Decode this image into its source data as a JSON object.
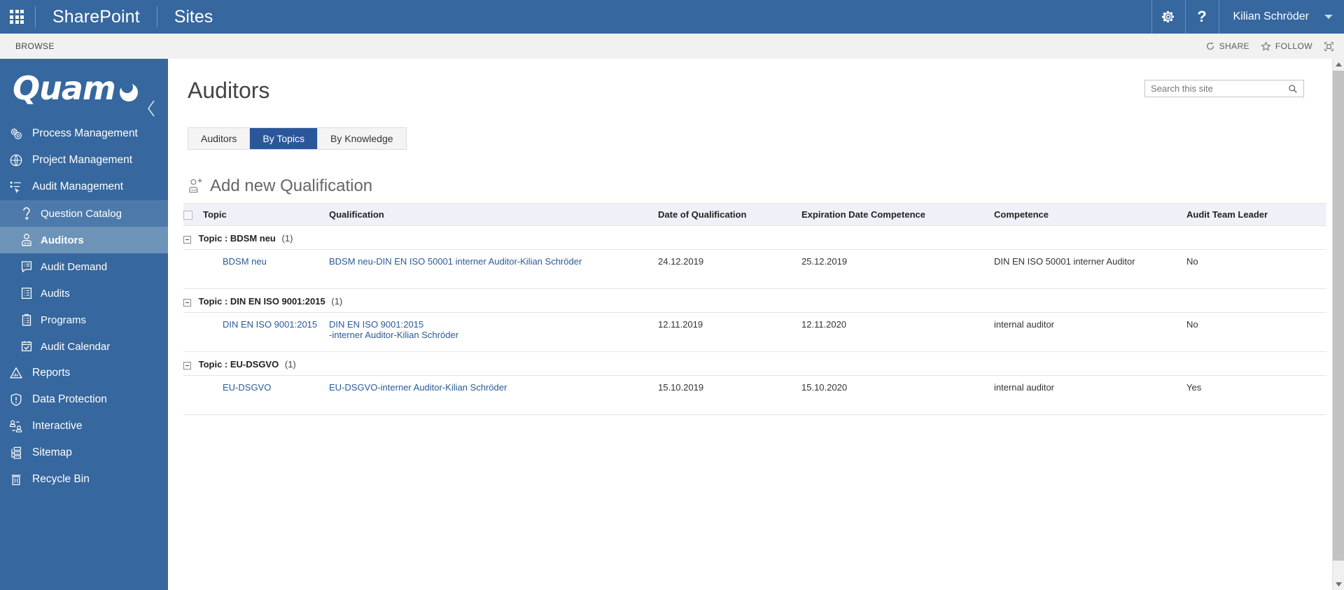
{
  "suite": {
    "waffle_icon": "app-launcher-icon",
    "brand": "SharePoint",
    "site": "Sites",
    "settings_icon": "gear-icon",
    "help_icon": "help-icon",
    "user_name": "Kilian Schröder",
    "user_caret_icon": "chevron-down-icon",
    "bar_color": "#36679e"
  },
  "ribbon": {
    "browse_tab": "BROWSE",
    "share_label": "SHARE",
    "share_icon": "share-icon",
    "follow_label": "FOLLOW",
    "follow_icon": "star-icon",
    "focus_icon": "focus-on-content-icon",
    "bar_color": "#f1f1f1"
  },
  "sidebar": {
    "logo_text": "Quam",
    "logo_mark_icon": "quam-circle-mark-icon",
    "collapse_icon": "chevron-left-icon",
    "background": "#36679e",
    "items": [
      {
        "label": "Process Management",
        "icon": "gears-icon",
        "level": "top",
        "state": "normal"
      },
      {
        "label": "Project Management",
        "icon": "globe-folder-icon",
        "level": "top",
        "state": "normal"
      },
      {
        "label": "Audit Management",
        "icon": "audit-list-cursor-icon",
        "level": "top",
        "state": "normal"
      },
      {
        "label": "Question Catalog",
        "icon": "question-mark-icon",
        "level": "sub",
        "state": "hover"
      },
      {
        "label": "Auditors",
        "icon": "person-badge-icon",
        "level": "sub",
        "state": "selected"
      },
      {
        "label": "Audit Demand",
        "icon": "list-speech-icon",
        "level": "sub",
        "state": "normal"
      },
      {
        "label": "Audits",
        "icon": "list-document-icon",
        "level": "sub",
        "state": "normal"
      },
      {
        "label": "Programs",
        "icon": "clipboard-list-icon",
        "level": "sub",
        "state": "normal"
      },
      {
        "label": "Audit Calendar",
        "icon": "calendar-check-icon",
        "level": "sub",
        "state": "normal"
      },
      {
        "label": "Reports",
        "icon": "chart-report-icon",
        "level": "top",
        "state": "normal"
      },
      {
        "label": "Data Protection",
        "icon": "shield-alert-icon",
        "level": "top",
        "state": "normal"
      },
      {
        "label": "Interactive",
        "icon": "people-exchange-icon",
        "level": "top",
        "state": "normal"
      },
      {
        "label": "Sitemap",
        "icon": "sitemap-icon",
        "level": "top",
        "state": "normal"
      },
      {
        "label": "Recycle Bin",
        "icon": "trash-icon",
        "level": "top",
        "state": "normal"
      }
    ]
  },
  "main": {
    "page_title": "Auditors",
    "search": {
      "placeholder": "Search this site",
      "value": "",
      "icon": "search-icon"
    },
    "tabs": [
      {
        "label": "Auditors",
        "active": false
      },
      {
        "label": "By Topics",
        "active": true
      },
      {
        "label": "By Knowledge",
        "active": false
      }
    ],
    "add_new": {
      "label": "Add new Qualification",
      "icon": "add-person-icon"
    },
    "table": {
      "select_all_icon": "checkbox-unchecked-icon",
      "columns": [
        "Topic",
        "Qualification",
        "Date of Qualification",
        "Expiration Date Competence",
        "Competence",
        "Audit Team Leader"
      ],
      "groups": [
        {
          "label": "Topic : BDSM neu",
          "count": "(1)",
          "collapse_icon": "minus-box-icon",
          "rows": [
            {
              "topic": "BDSM neu",
              "qualification": "BDSM neu-DIN EN ISO 50001 interner Auditor-Kilian Schröder",
              "date_of_qualification": "24.12.2019",
              "expiration_date": "25.12.2019",
              "competence": "DIN EN ISO 50001 interner Auditor",
              "audit_team_leader": "No"
            }
          ]
        },
        {
          "label": "Topic : DIN EN ISO 9001:2015",
          "count": "(1)",
          "collapse_icon": "minus-box-icon",
          "rows": [
            {
              "topic": "DIN EN ISO 9001:2015",
              "qualification": "DIN EN ISO 9001:2015\n-interner Auditor-Kilian Schröder",
              "date_of_qualification": "12.11.2019",
              "expiration_date": "12.11.2020",
              "competence": "internal auditor",
              "audit_team_leader": "No"
            }
          ]
        },
        {
          "label": "Topic : EU-DSGVO",
          "count": "(1)",
          "collapse_icon": "minus-box-icon",
          "rows": [
            {
              "topic": "EU-DSGVO",
              "qualification": "EU-DSGVO-interner Auditor-Kilian Schröder",
              "date_of_qualification": "15.10.2019",
              "expiration_date": "15.10.2020",
              "competence": "internal auditor",
              "audit_team_leader": "Yes"
            }
          ]
        }
      ]
    }
  },
  "scrollbar": {
    "up_icon": "scroll-up-arrow-icon",
    "down_icon": "scroll-down-arrow-icon"
  }
}
